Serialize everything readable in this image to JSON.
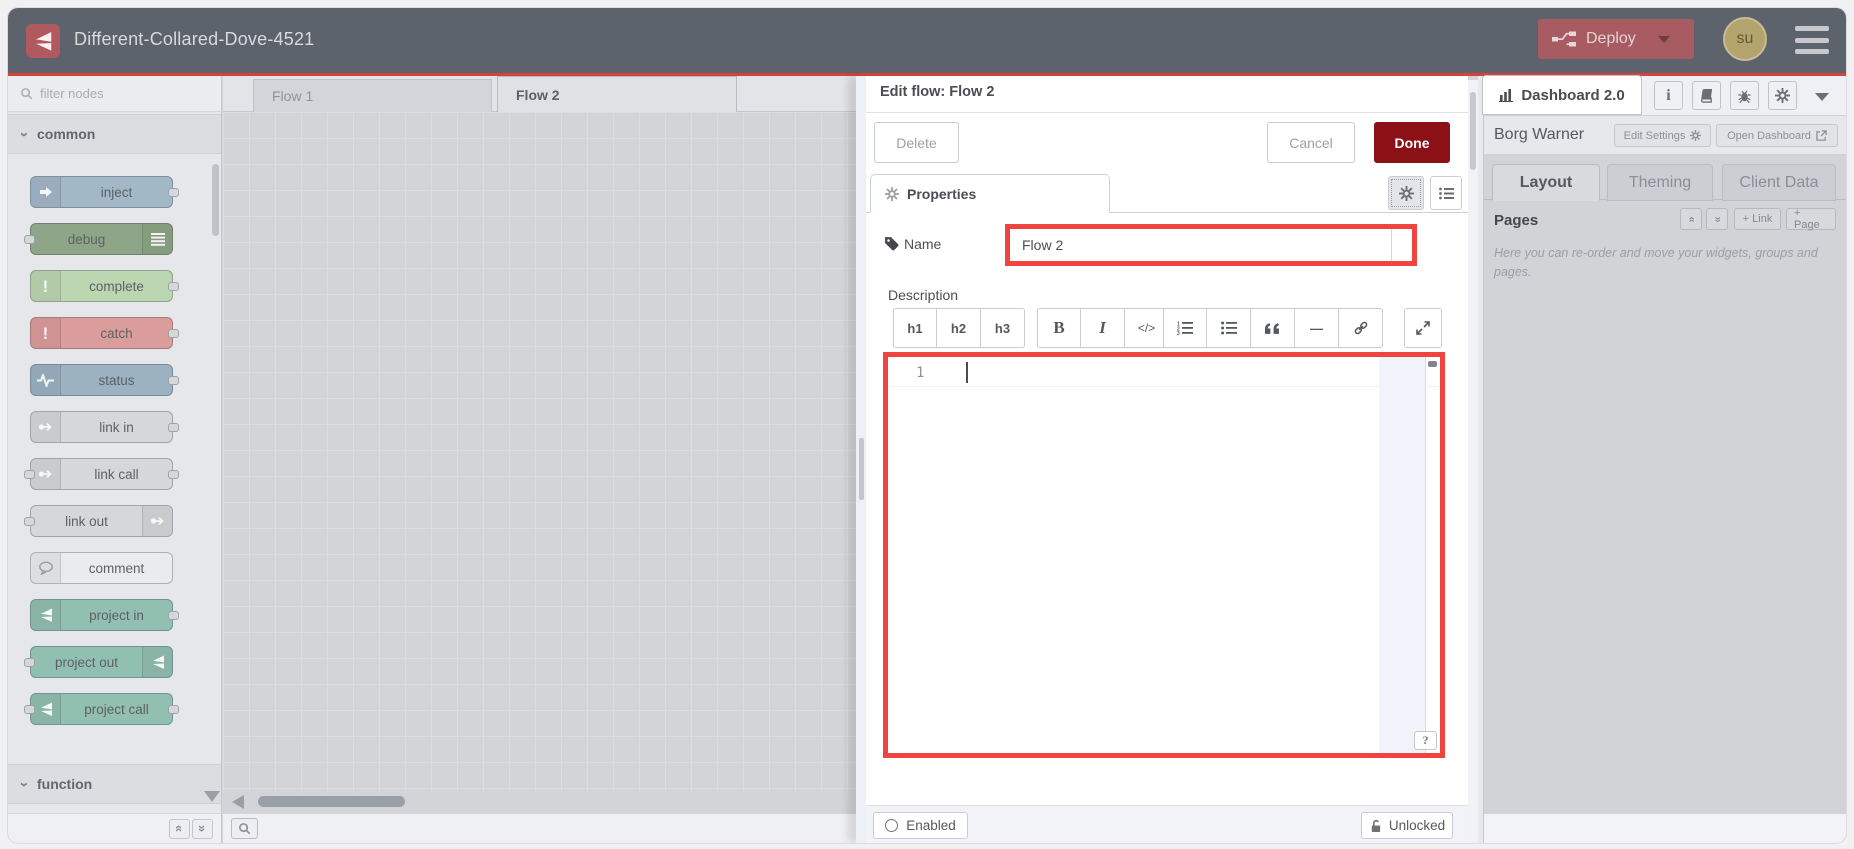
{
  "header": {
    "title": "Different-Collared-Dove-4521",
    "deploy_label": "Deploy",
    "avatar_initials": "su"
  },
  "palette": {
    "filter_placeholder": "filter nodes",
    "categories": [
      {
        "label": "common"
      },
      {
        "label": "function"
      }
    ],
    "nodes": [
      {
        "label": "inject",
        "color": "#a2b8c7",
        "icon": "inject-arrow-icon",
        "icon_side": "left",
        "ports": [
          "right"
        ]
      },
      {
        "label": "debug",
        "color": "#8ea687",
        "icon": "debug-list-icon",
        "icon_side": "right",
        "ports": [
          "left"
        ]
      },
      {
        "label": "complete",
        "color": "#bdd6b2",
        "icon": "exclamation-icon",
        "icon_side": "left",
        "ports": [
          "right"
        ]
      },
      {
        "label": "catch",
        "color": "#db9d9b",
        "icon": "exclamation-icon",
        "icon_side": "left",
        "ports": [
          "right"
        ]
      },
      {
        "label": "status",
        "color": "#9cb2c1",
        "icon": "pulse-icon",
        "icon_side": "left",
        "ports": [
          "right"
        ]
      },
      {
        "label": "link in",
        "color": "#d6d7d9",
        "icon": "link-icon",
        "icon_side": "left",
        "ports": [
          "right"
        ]
      },
      {
        "label": "link call",
        "color": "#d6d7d9",
        "icon": "link-icon",
        "icon_side": "left",
        "ports": [
          "left",
          "right"
        ]
      },
      {
        "label": "link out",
        "color": "#d6d7d9",
        "icon": "link-icon",
        "icon_side": "right",
        "ports": [
          "left"
        ]
      },
      {
        "label": "comment",
        "color": "#eaebed",
        "icon": "comment-bubble-icon",
        "icon_side": "left",
        "ports": []
      },
      {
        "label": "project in",
        "color": "#92c0b0",
        "icon": "node-red-icon",
        "icon_side": "left",
        "ports": [
          "right"
        ]
      },
      {
        "label": "project out",
        "color": "#92c0b0",
        "icon": "node-red-icon",
        "icon_side": "right",
        "ports": [
          "left"
        ]
      },
      {
        "label": "project call",
        "color": "#92c0b0",
        "icon": "node-red-icon",
        "icon_side": "left",
        "ports": [
          "left",
          "right"
        ]
      }
    ]
  },
  "workspace": {
    "tabs": [
      {
        "label": "Flow 1",
        "active": false
      },
      {
        "label": "Flow 2",
        "active": true
      }
    ]
  },
  "tray": {
    "title": "Edit flow: Flow 2",
    "delete_label": "Delete",
    "cancel_label": "Cancel",
    "done_label": "Done",
    "properties_tab": "Properties",
    "name_label": "Name",
    "name_value": "Flow 2",
    "description_label": "Description",
    "toolbar_groups": [
      [
        {
          "name": "heading1",
          "glyph": "h1"
        },
        {
          "name": "heading2",
          "glyph": "h2"
        },
        {
          "name": "heading3",
          "glyph": "h3"
        }
      ],
      [
        {
          "name": "bold",
          "glyph": "B",
          "cls": "md-b"
        },
        {
          "name": "italic",
          "glyph": "I",
          "cls": "md-i"
        },
        {
          "name": "code",
          "glyph": "</>",
          "cls": "md-code"
        }
      ],
      [
        {
          "name": "ordered-list",
          "icon": "ol-icon"
        },
        {
          "name": "unordered-list",
          "icon": "ul-icon"
        },
        {
          "name": "quote",
          "icon": "quote-icon"
        },
        {
          "name": "horizontal-rule",
          "glyph": "—"
        },
        {
          "name": "link",
          "icon": "chain-icon"
        }
      ]
    ],
    "editor": {
      "line_number": "1"
    },
    "help_button": "?",
    "enabled_label": "Enabled",
    "unlocked_label": "Unlocked"
  },
  "sidebar": {
    "tab_label": "Dashboard 2.0",
    "toolbar_icons": [
      "info-icon",
      "book-icon",
      "bug-icon",
      "gear-icon"
    ],
    "project_name": "Borg Warner",
    "edit_settings_label": "Edit Settings",
    "open_dashboard_label": "Open Dashboard",
    "tabs": [
      {
        "label": "Layout",
        "active": true
      },
      {
        "label": "Theming",
        "active": false
      },
      {
        "label": "Client Data",
        "active": false
      }
    ],
    "pages_label": "Pages",
    "link_button": "+ Link",
    "page_button": "+ Page",
    "help_text": "Here you can re-order and move your widgets, groups and pages."
  },
  "colors": {
    "header_bg": "#5c636d",
    "accent_red_line": "#d6413b",
    "deploy_red": "#a85b60",
    "done_red": "#8c1117",
    "highlight_red": "#ef4440"
  }
}
